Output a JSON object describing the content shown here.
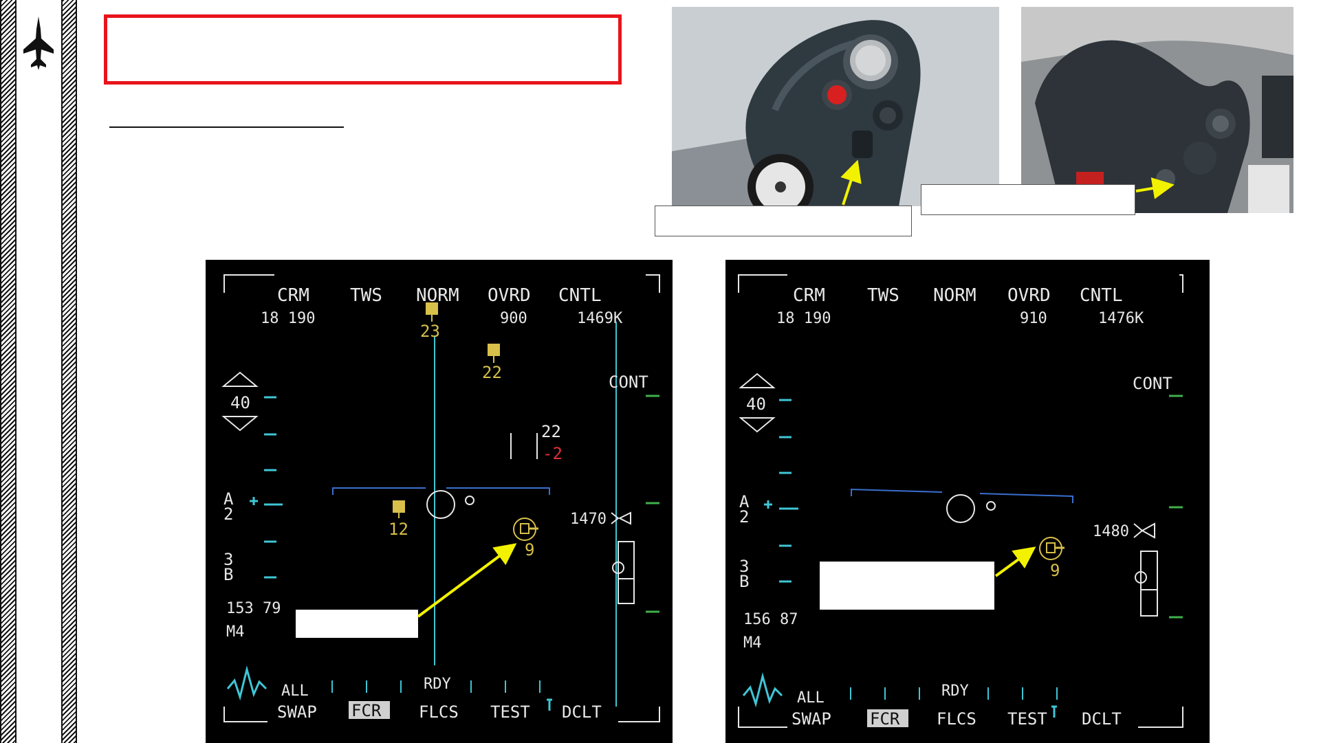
{
  "page": {
    "title_box_text": "",
    "subtitle_text": "",
    "grip_label_text": "",
    "throttle_label_text": "",
    "left_callout_text": "",
    "right_callout_text": ""
  },
  "mfd_left": {
    "top_osb": [
      "CRM",
      "TWS",
      "NORM",
      "OVRD",
      "CNTL"
    ],
    "range_values": "18  190",
    "ovrd_value": "900",
    "cntl_value": "1469K",
    "range_scale": "40",
    "cont_label": "CONT",
    "az_label_top": "A",
    "az_label_top2": "2",
    "bar_label_top": "3",
    "bar_label_bot": "B",
    "bottom_left_values": "153  79",
    "mode_label": "M4",
    "target_labels": [
      "23",
      "22",
      "12"
    ],
    "target_alt": "9",
    "cursor_upper": "22",
    "cursor_lower": "-2",
    "range_readout": "1470",
    "bottom_osb_top": [
      "ALL",
      "RDY"
    ],
    "bottom_osb": [
      "SWAP",
      "FCR",
      "FLCS",
      "TEST",
      "DCLT"
    ]
  },
  "mfd_right": {
    "top_osb": [
      "CRM",
      "TWS",
      "NORM",
      "OVRD",
      "CNTL"
    ],
    "range_values": "18  190",
    "ovrd_value": "910",
    "cntl_value": "1476K",
    "range_scale": "40",
    "cont_label": "CONT",
    "az_label_top": "A",
    "az_label_top2": "2",
    "bar_label_top": "3",
    "bar_label_bot": "B",
    "bottom_left_values": "156  87",
    "mode_label": "M4",
    "target_alt": "9",
    "range_readout": "1480",
    "bottom_osb_top": [
      "ALL",
      "RDY"
    ],
    "bottom_osb": [
      "SWAP",
      "FCR",
      "FLCS",
      "TEST",
      "DCLT"
    ]
  },
  "colors": {
    "accent_red": "#e8141b",
    "arrow_yellow": "#f2f200",
    "mfd_white": "#e8e8e8",
    "mfd_cyan": "#3fc6d6",
    "mfd_yellow": "#d8c04a",
    "mfd_red": "#e0303a",
    "mfd_green": "#3fb04a",
    "mfd_blue": "#3a6fd0"
  },
  "icons": {
    "logo": "jet-silhouette-icon"
  }
}
